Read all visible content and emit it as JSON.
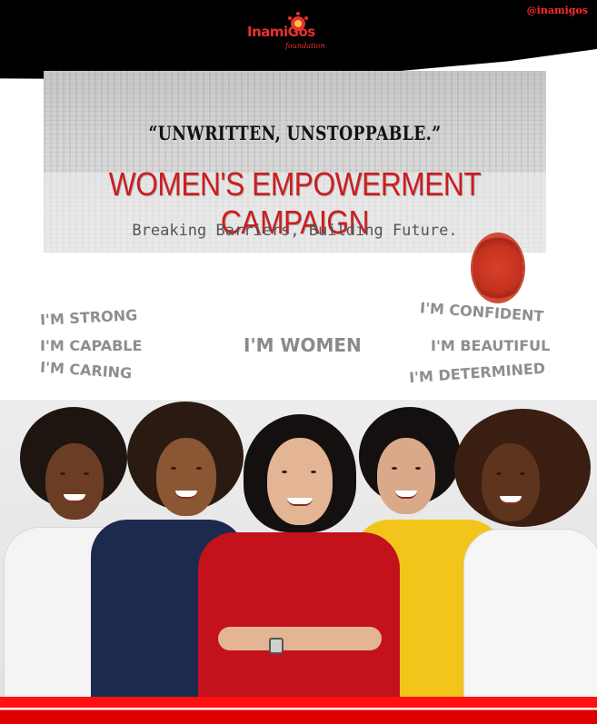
{
  "header": {
    "handle": "@inamigos",
    "logo_name": "InamiGos",
    "logo_sub": "foundation"
  },
  "banner": {
    "quote": "“UNWRITTEN, UNSTOPPABLE.”",
    "title": "WOMEN'S EMPOWERMENT CAMPAIGN",
    "tagline": "Breaking Barriers, Building Future."
  },
  "affirmations": {
    "strong": "I'M STRONG",
    "capable": "I'M CAPABLE",
    "caring": "I'M CARING",
    "women": "I'M WOMEN",
    "confident": "I'M CONFIDENT",
    "beautiful": "I'M BEAUTIFUL",
    "determined": "I'M DETERMINED"
  },
  "colors": {
    "brand_red": "#cc1d20",
    "header_black": "#000000",
    "affirmation_gray": "#8e8e8e"
  }
}
